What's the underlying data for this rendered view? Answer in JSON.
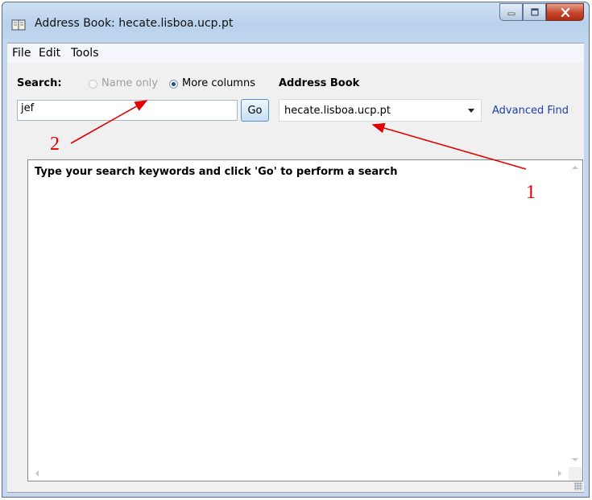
{
  "window": {
    "title": "Address Book: hecate.lisboa.ucp.pt"
  },
  "menu": {
    "file": "File",
    "edit": "Edit",
    "tools": "Tools"
  },
  "search": {
    "label": "Search:",
    "name_only_label": "Name only",
    "more_columns_label": "More columns",
    "query_value": "jef",
    "go_label": "Go"
  },
  "address_book": {
    "label": "Address Book",
    "selected": "hecate.lisboa.ucp.pt"
  },
  "advanced_find_label": "Advanced Find",
  "results": {
    "message": "Type your search keywords and click 'Go' to perform a search"
  },
  "annotations": {
    "marker_1": "1",
    "marker_2": "2",
    "color": "#e00000"
  }
}
